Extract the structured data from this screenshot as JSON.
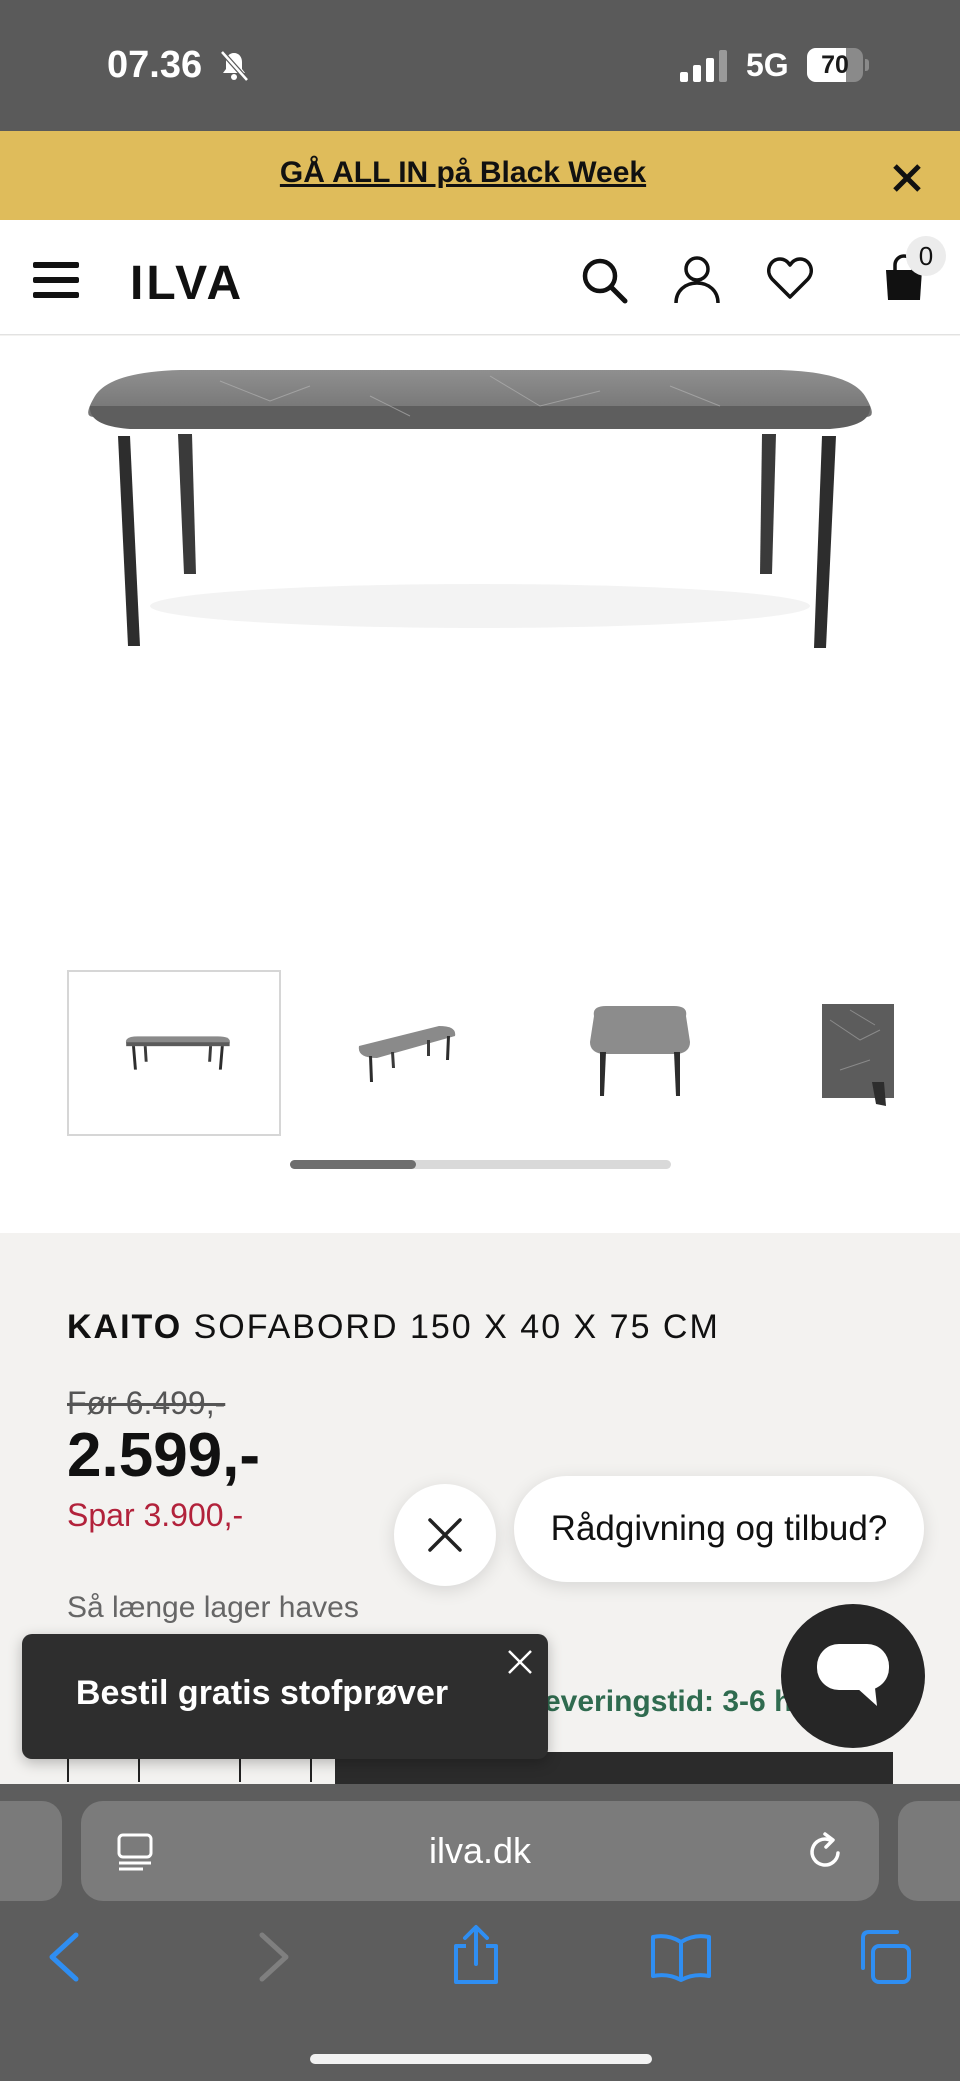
{
  "status_bar": {
    "time": "07.36",
    "network": "5G",
    "battery_level": "70",
    "battery_fraction": 0.7,
    "icons": [
      "bell-muted-icon",
      "signal-icon",
      "battery-icon"
    ]
  },
  "promo": {
    "text": "GÅ ALL IN på Black Week",
    "close_icon": "close-icon"
  },
  "header": {
    "logo": "ILVA",
    "cart_count": "0",
    "icons": [
      "menu-icon",
      "search-icon",
      "account-icon",
      "wishlist-icon",
      "cart-icon"
    ]
  },
  "gallery": {
    "thumbnails": [
      "front-view",
      "angled-view",
      "top-view",
      "marble-detail"
    ],
    "active_index": 0,
    "scroll_fraction": 0.33
  },
  "product": {
    "brand": "KAITO",
    "name": "SOFABORD 150 X 40 X 75 CM",
    "old_price": "Før 6.499,-",
    "price": "2.599,-",
    "savings": "Spar 3.900,-",
    "stock_note": "Så længe lager haves",
    "delivery": "everingstid: 3-6 h"
  },
  "chat": {
    "prompt": "Rådgivning og tilbud?",
    "icons": [
      "close-icon",
      "chat-icon"
    ]
  },
  "toast": {
    "text": "Bestil gratis stofprøver",
    "close_icon": "close-icon"
  },
  "browser": {
    "url": "ilva.dk",
    "icons": [
      "page-menu-icon",
      "reload-icon",
      "back-icon",
      "forward-icon",
      "share-icon",
      "bookmarks-icon",
      "tabs-icon"
    ]
  },
  "colors": {
    "promo_bg": "#dfbc5b",
    "savings_red": "#b2223b",
    "delivery_green": "#2f6b4f",
    "chat_dark": "#262626"
  }
}
